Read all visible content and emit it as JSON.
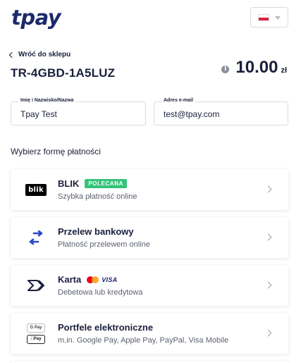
{
  "brand": {
    "logo_text": "tpay"
  },
  "language": {
    "selected": "PL",
    "flag_colors": [
      "#ffffff",
      "#d8243c"
    ]
  },
  "header": {
    "back_label": "Wróć do sklepu",
    "transaction_id": "TR-4GBD-1A5LUZ",
    "amount": "10.00",
    "currency": "zł"
  },
  "form": {
    "name": {
      "label": "Imię i Nazwisko/Nazwa",
      "value": "Tpay Test"
    },
    "email": {
      "label": "Adres e-mail",
      "value": "test@tpay.com"
    }
  },
  "payment_section": {
    "title": "Wybierz formę płatności",
    "methods": [
      {
        "title": "BLIK",
        "subtitle": "Szybka płatność online",
        "badge": "POLECANA",
        "icon": "blik-logo",
        "icon_text": "blik"
      },
      {
        "title": "Przelew bankowy",
        "subtitle": "Płatność przelewem online",
        "icon": "transfer-arrows-icon"
      },
      {
        "title": "Karta",
        "subtitle": "Debetowa lub kredytowa",
        "icon": "card-icon",
        "brands": [
          "mastercard",
          "VISA"
        ]
      },
      {
        "title": "Portfele elektroniczne",
        "subtitle": "m.in. Google Pay, Apple Pay, PayPal, Visa Mobile",
        "icon": "wallets-icon",
        "chips": [
          "G Pay",
          "Pay"
        ]
      }
    ]
  },
  "colors": {
    "accent": "#1c2a6b",
    "badge": "#34c37a",
    "text": "#1a1f3c",
    "muted": "#5d6270"
  }
}
